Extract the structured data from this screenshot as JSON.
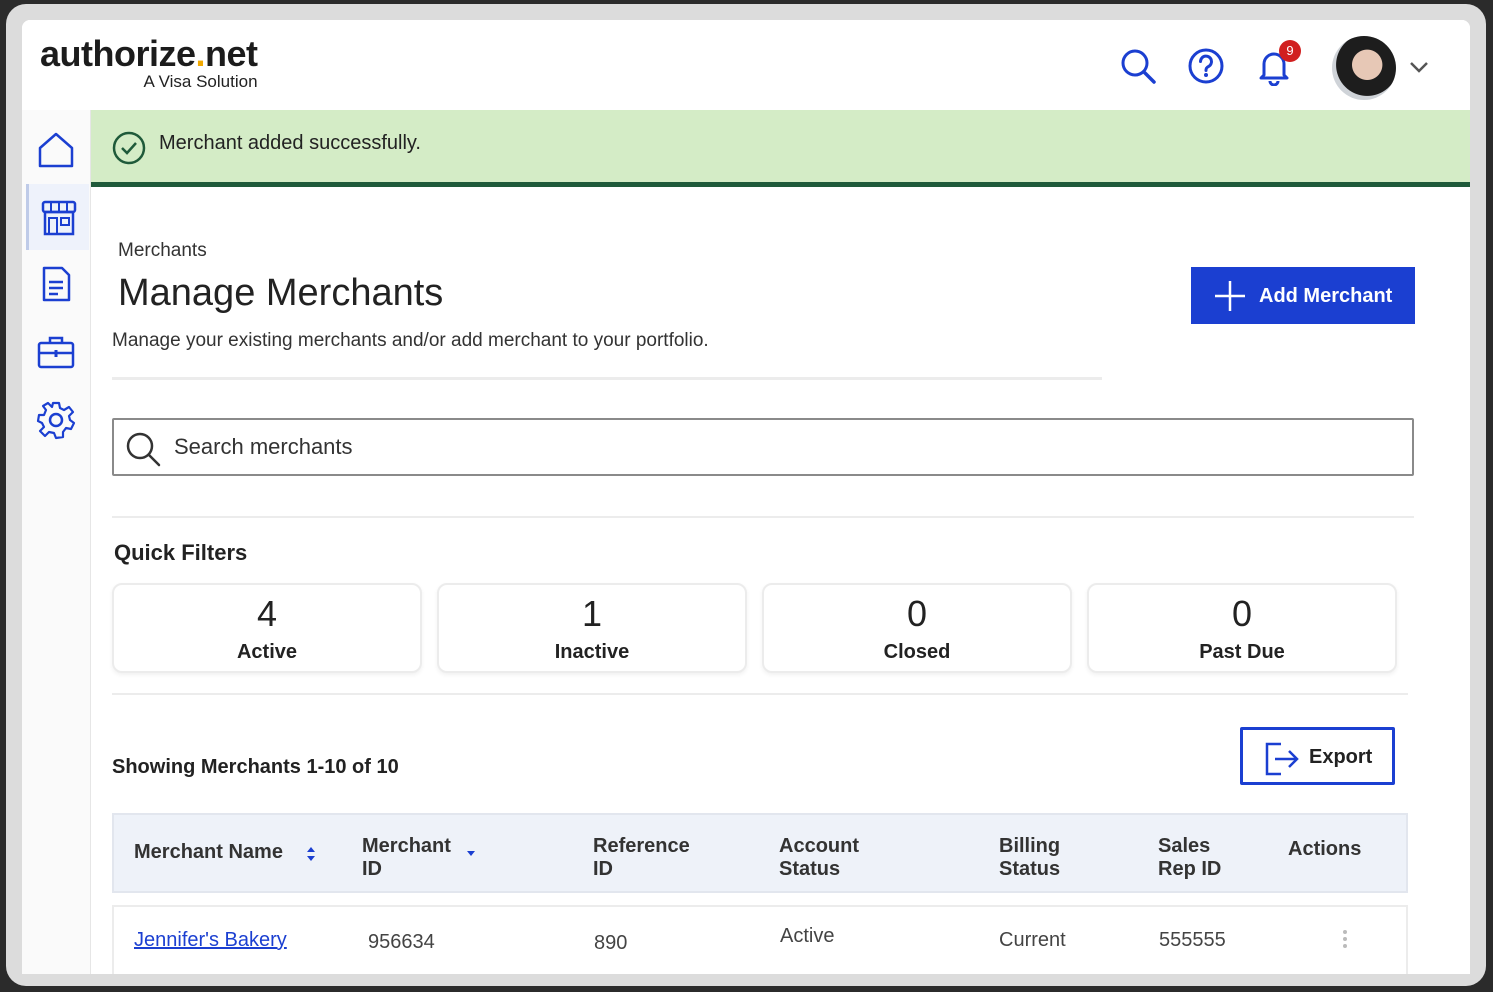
{
  "header": {
    "logo_main_a": "authorize",
    "logo_main_dot": ".",
    "logo_main_b": "net",
    "logo_sub": "A Visa Solution",
    "icons": [
      "search-icon",
      "help-icon",
      "bell-icon"
    ],
    "notification_count": "9"
  },
  "sidebar": {
    "items": [
      {
        "name": "home",
        "icon": "home-icon"
      },
      {
        "name": "merchants",
        "icon": "storefront-icon",
        "active": true
      },
      {
        "name": "reports",
        "icon": "document-icon"
      },
      {
        "name": "portfolio",
        "icon": "briefcase-icon"
      },
      {
        "name": "settings",
        "icon": "gear-icon"
      }
    ]
  },
  "banner": {
    "text": "Merchant added successfully.",
    "color": "#d4ecc6",
    "accent": "#1f5a3a"
  },
  "page": {
    "breadcrumb": "Merchants",
    "title": "Manage Merchants",
    "description": "Manage your existing merchants and/or add merchant to your portfolio.",
    "add_button": "Add Merchant",
    "accent": "#1b3fd1"
  },
  "search": {
    "placeholder": "Search merchants"
  },
  "quick_filters": {
    "title": "Quick Filters",
    "cards": [
      {
        "count": "4",
        "label": "Active"
      },
      {
        "count": "1",
        "label": "Inactive"
      },
      {
        "count": "0",
        "label": "Closed"
      },
      {
        "count": "0",
        "label": "Past Due"
      }
    ]
  },
  "results": {
    "showing": "Showing Merchants 1-10 of 10",
    "export_button": "Export"
  },
  "table": {
    "columns": [
      {
        "line1": "Merchant Name",
        "line2": ""
      },
      {
        "line1": "Merchant",
        "line2": "ID"
      },
      {
        "line1": "Reference",
        "line2": "ID"
      },
      {
        "line1": "Account",
        "line2": "Status"
      },
      {
        "line1": "Billing",
        "line2": "Status"
      },
      {
        "line1": "Sales",
        "line2": "Rep ID"
      },
      {
        "line1": "Actions",
        "line2": ""
      }
    ],
    "rows": [
      {
        "merchant_name": "Jennifer's Bakery",
        "merchant_id": "956634",
        "reference_id": "890",
        "account_status": "Active",
        "billing_status": "Current",
        "sales_rep_id": "555555"
      }
    ]
  }
}
